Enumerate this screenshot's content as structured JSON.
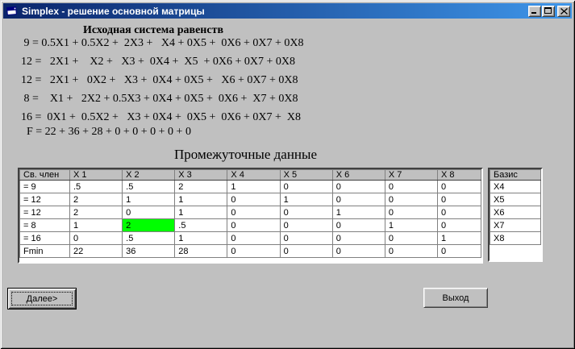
{
  "window": {
    "title": "Simplex - решение основной матрицы",
    "controls": {
      "minimize": "minimize",
      "maximize": "maximize",
      "close": "close"
    }
  },
  "headings": {
    "system": "Исходная система равенств",
    "intermediate": "Промежуточные данные"
  },
  "equations": [
    " 9 = 0.5X1 + 0.5X2 +  2X3 +   X4 + 0X5 +  0X6 + 0X7 + 0X8",
    "12 =   2X1 +    X2 +   X3 +  0X4 +  X5  + 0X6 + 0X7 + 0X8",
    "12 =   2X1 +   0X2 +   X3 +  0X4 + 0X5 +   X6 + 0X7 + 0X8",
    " 8 =    X1 +   2X2 + 0.5X3 + 0X4 + 0X5 +  0X6 +  X7 + 0X8",
    "16 =  0X1 +  0.5X2 +   X3 + 0X4 +  0X5 +  0X6 + 0X7 +  X8",
    "  F = 22 + 36 + 28 + 0 + 0 + 0 + 0 + 0"
  ],
  "table": {
    "columns": [
      "Св. член",
      "X 1",
      "X 2",
      "X 3",
      "X 4",
      "X 5",
      "X 6",
      "X 7",
      "X 8"
    ],
    "rows": [
      {
        "label": "= 9",
        "values": [
          ".5",
          ".5",
          "2",
          "1",
          "0",
          "0",
          "0",
          "0"
        ],
        "highlight_col": null
      },
      {
        "label": "= 12",
        "values": [
          "2",
          "1",
          "1",
          "0",
          "1",
          "0",
          "0",
          "0"
        ],
        "highlight_col": null
      },
      {
        "label": "= 12",
        "values": [
          "2",
          "0",
          "1",
          "0",
          "0",
          "1",
          "0",
          "0"
        ],
        "highlight_col": null
      },
      {
        "label": "= 8",
        "values": [
          "1",
          "2",
          ".5",
          "0",
          "0",
          "0",
          "1",
          "0"
        ],
        "highlight_col": 1
      },
      {
        "label": "= 16",
        "values": [
          "0",
          ".5",
          "1",
          "0",
          "0",
          "0",
          "0",
          "1"
        ],
        "highlight_col": null
      },
      {
        "label": "Fmin",
        "values": [
          "22",
          "36",
          "28",
          "0",
          "0",
          "0",
          "0",
          "0"
        ],
        "highlight_col": null
      }
    ]
  },
  "basis": {
    "header": "Базис",
    "items": [
      "X4",
      "X5",
      "X6",
      "X7",
      "X8"
    ]
  },
  "buttons": {
    "next": "Далее>",
    "exit": "Выход"
  },
  "colors": {
    "pivot_highlight": "#00FF00",
    "titlebar_left": "#0a246a",
    "titlebar_right": "#3e96ea",
    "window_face": "#c0c0c0"
  }
}
